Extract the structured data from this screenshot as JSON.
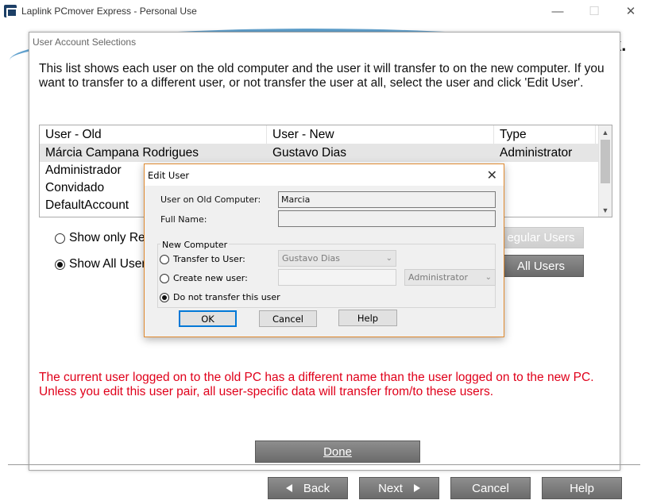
{
  "window": {
    "title": "Laplink PCmover Express - Personal Use",
    "minimize_glyph": "—",
    "maximize_glyph": "☐",
    "close_glyph": "✕",
    "brand_fragment": "k."
  },
  "panel": {
    "title": "User Account Selections",
    "intro": "This list shows each user on the old computer and the user it will transfer to on the new computer. If you want to transfer to a different user, or not transfer the user at all, select the user and click 'Edit User'.",
    "columns": [
      "User - Old",
      "User - New",
      "Type"
    ],
    "rows": [
      {
        "old": "Márcia Campana Rodrigues",
        "new": "Gustavo Dias",
        "type": "Administrator"
      },
      {
        "old": "Administrador",
        "new": "",
        "type": ""
      },
      {
        "old": "Convidado",
        "new": "",
        "type": ""
      },
      {
        "old": "DefaultAccount",
        "new": "",
        "type": ""
      }
    ],
    "radio_show_only": "Show only Re",
    "radio_show_all": "Show All User",
    "btn_regular_users": "egular Users",
    "btn_all_users": "All Users",
    "warning": "The current user logged on to the old PC has a different name than the user logged on to the new PC. Unless you edit this user pair, all user-specific data will transfer from/to these users.",
    "done_label": "Done"
  },
  "footer": {
    "back": "Back",
    "next": "Next",
    "cancel": "Cancel",
    "help": "Help"
  },
  "dialog": {
    "title": "Edit User",
    "close_glyph": "✕",
    "label_old_user": "User on Old Computer:",
    "value_old_user": "Marcia",
    "label_full_name": "Full Name:",
    "value_full_name": "",
    "group_label": "New Computer",
    "radio_transfer": "Transfer to User:",
    "transfer_select": "Gustavo Dias",
    "radio_create": "Create new user:",
    "create_type_select": "Administrator",
    "radio_no_transfer": "Do not transfer this user",
    "ok": "OK",
    "cancel": "Cancel",
    "help": "Help"
  },
  "colors": {
    "warning": "#e0001a",
    "dialog_border": "#e08a2f",
    "button_grey": "#7b7b7b",
    "focus_blue": "#0078d7"
  }
}
